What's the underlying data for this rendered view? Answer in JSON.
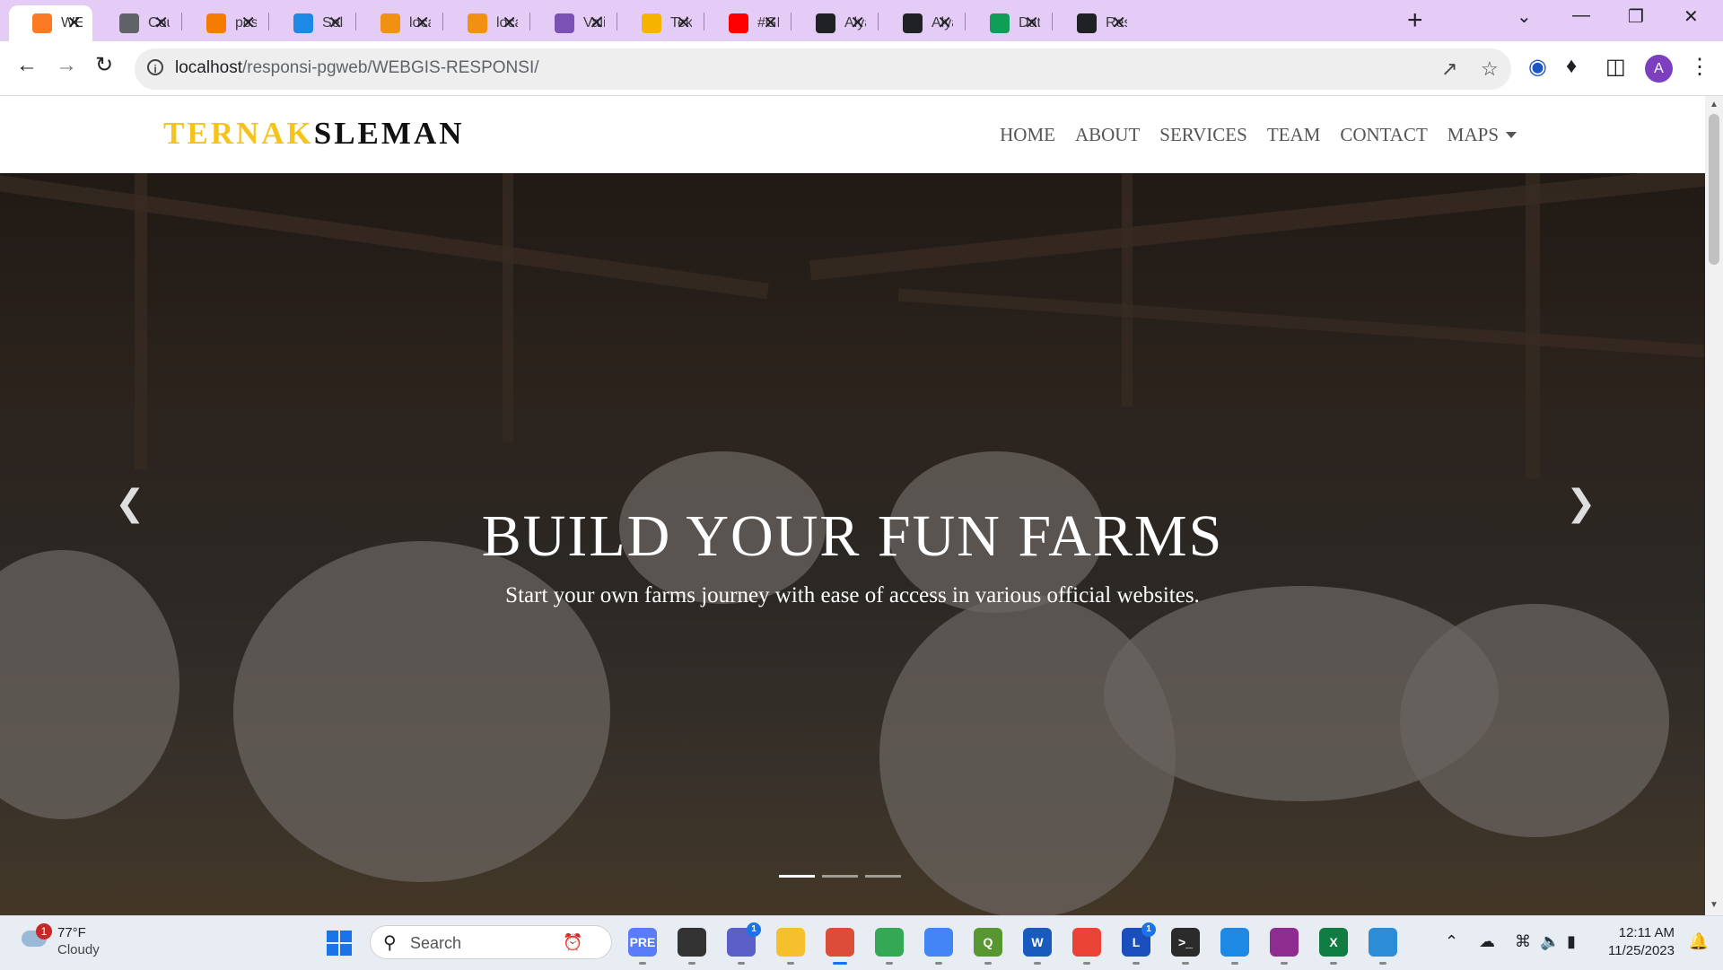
{
  "browser": {
    "tabs": [
      {
        "title": "WEB",
        "favicon": "xampp",
        "color": "#fb7a24",
        "active": true
      },
      {
        "title": "Cou",
        "favicon": "globe",
        "color": "#5f6368"
      },
      {
        "title": "pos",
        "favicon": "pos",
        "color": "#f57c00"
      },
      {
        "title": "Sela",
        "favicon": "snowflake",
        "color": "#1e88e5"
      },
      {
        "title": "loca",
        "favicon": "phpmyadmin",
        "color": "#f29111"
      },
      {
        "title": "loca",
        "favicon": "phpmyadmin",
        "color": "#f29111"
      },
      {
        "title": "Vali",
        "favicon": "bootstrap",
        "color": "#7952b3"
      },
      {
        "title": "Tekı",
        "favicon": "slides",
        "color": "#f4b400"
      },
      {
        "title": "#GI",
        "favicon": "youtube",
        "color": "#ff0000"
      },
      {
        "title": "Alya",
        "favicon": "github",
        "color": "#202124"
      },
      {
        "title": "Alya",
        "favicon": "github",
        "color": "#202124"
      },
      {
        "title": "Dat",
        "favicon": "sheets",
        "color": "#0f9d58"
      },
      {
        "title": "Res",
        "favicon": "github",
        "color": "#202124"
      }
    ],
    "url_host": "localhost",
    "url_path": "/responsi-pgweb/WEBGIS-RESPONSI/",
    "profile_initial": "A"
  },
  "site": {
    "brand_part1": "TERNAK",
    "brand_part2": "SLEMAN",
    "nav": [
      "HOME",
      "ABOUT",
      "SERVICES",
      "TEAM",
      "CONTACT",
      "MAPS"
    ],
    "hero_title": "BUILD YOUR FUN FARMS",
    "hero_subtitle": "Start your own farms journey with ease of access in various official websites.",
    "carousel_active_index": 0,
    "carousel_count": 3
  },
  "taskbar": {
    "weather_temp": "77°F",
    "weather_desc": "Cloudy",
    "weather_badge": "1",
    "search_placeholder": "Search",
    "time": "12:11 AM",
    "date": "11/25/2023",
    "apps": [
      {
        "name": "copilot-pre",
        "color": "#5b7cfa",
        "label": "PRE"
      },
      {
        "name": "task-view",
        "color": "#333333",
        "label": ""
      },
      {
        "name": "teams-chat",
        "color": "#5b5fc7",
        "label": "",
        "badge": "1"
      },
      {
        "name": "file-explorer",
        "color": "#f6c02c",
        "label": ""
      },
      {
        "name": "chrome-a",
        "color": "#dd4b39",
        "label": "",
        "active": true
      },
      {
        "name": "chrome",
        "color": "#34a853",
        "label": ""
      },
      {
        "name": "chrome-b",
        "color": "#4285f4",
        "label": ""
      },
      {
        "name": "qgis",
        "color": "#589632",
        "label": "Q"
      },
      {
        "name": "word",
        "color": "#185abd",
        "label": "W"
      },
      {
        "name": "chrome-n",
        "color": "#ea4335",
        "label": ""
      },
      {
        "name": "lingo",
        "color": "#1a4ebd",
        "label": "L",
        "badge": "1"
      },
      {
        "name": "terminal",
        "color": "#2b2b2b",
        "label": ">_"
      },
      {
        "name": "vscode",
        "color": "#1e88e5",
        "label": ""
      },
      {
        "name": "winrar",
        "color": "#8e2c8f",
        "label": ""
      },
      {
        "name": "excel",
        "color": "#107c41",
        "label": "X"
      },
      {
        "name": "maps-app",
        "color": "#2d8cd8",
        "label": ""
      }
    ]
  }
}
